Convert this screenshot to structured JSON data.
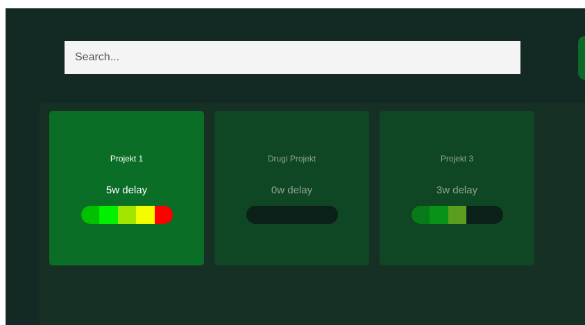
{
  "search": {
    "placeholder": "Search..."
  },
  "colors": {
    "app_background": "#132a24",
    "board_background": "#163026",
    "card_active": "#0b6e27",
    "card_inactive": "#0f4624",
    "bar_track": "#0a2019"
  },
  "projects": [
    {
      "name": "Projekt 1",
      "delay_label": "5w delay",
      "delay_weeks": 5,
      "max_weeks": 5,
      "active": true,
      "segment_colors": [
        "#00c000",
        "#00f000",
        "#a2e600",
        "#f4fc00",
        "#ff0000"
      ]
    },
    {
      "name": "Drugi Projekt",
      "delay_label": "0w delay",
      "delay_weeks": 0,
      "max_weeks": 5,
      "active": false,
      "segment_colors": []
    },
    {
      "name": "Projekt 3",
      "delay_label": "3w delay",
      "delay_weeks": 3,
      "max_weeks": 5,
      "active": false,
      "segment_colors": [
        "#087a1a",
        "#089316",
        "#5a9d1f"
      ]
    }
  ]
}
